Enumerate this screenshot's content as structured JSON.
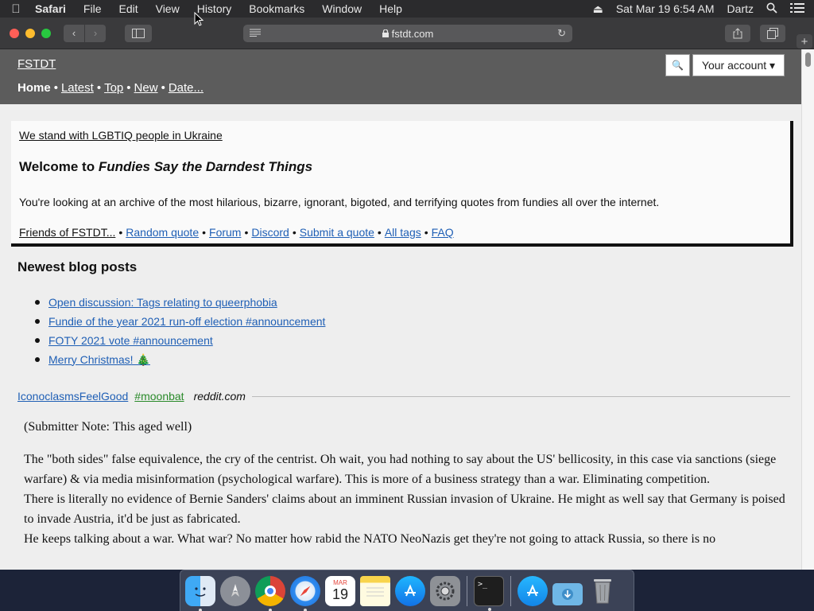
{
  "menubar": {
    "app": "Safari",
    "items": [
      "File",
      "Edit",
      "View",
      "History",
      "Bookmarks",
      "Window",
      "Help"
    ],
    "datetime": "Sat Mar 19  6:54 AM",
    "user": "Dartz"
  },
  "toolbar": {
    "url": "fstdt.com"
  },
  "site": {
    "title": "FSTDT",
    "nav": [
      "Home",
      "Latest",
      "Top",
      "New",
      "Date..."
    ],
    "search_icon": "🔍",
    "account_label": "Your account ▾"
  },
  "welcome": {
    "ukraine": "We stand with LGBTIQ people in Ukraine",
    "heading_prefix": "Welcome to ",
    "heading_em": "Fundies Say the Darndest Things",
    "description": "You're looking at an archive of the most hilarious, bizarre, ignorant, bigoted, and terrifying quotes from fundies all over the internet.",
    "friends": "Friends of FSTDT...",
    "links": [
      "Random quote",
      "Forum",
      "Discord",
      "Submit a quote",
      "All tags",
      "FAQ"
    ]
  },
  "blog": {
    "heading": "Newest blog posts",
    "posts": [
      "Open discussion: Tags relating to queerphobia",
      "Fundie of the year 2021 run-off election #announcement",
      "FOTY 2021 vote #announcement",
      "Merry Christmas! 🎄"
    ]
  },
  "quote": {
    "user": "IconoclasmsFeelGood",
    "tag": "#moonbat",
    "source": "reddit.com",
    "note": "(Submitter Note: This aged well)",
    "paragraphs": [
      "The \"both sides\" false equivalence, the cry of the centrist. Oh wait, you had nothing to say about the US' bellicosity, in this case via sanctions (siege warfare) & via media misinformation (psychological warfare). This is more of a business strategy than a war. Eliminating competition.",
      "There is literally no evidence of Bernie Sanders' claims about an imminent Russian invasion of Ukraine. He might as well say that Germany is poised to invade Austria, it'd be just as fabricated.",
      "He keeps talking about a war. What war? No matter how rabid the NATO NeoNazis get they're not going to attack Russia, so there is no"
    ]
  },
  "dock": {
    "calendar_month": "MAR",
    "calendar_day": "19"
  },
  "icons": [
    "apple-icon",
    "eject-icon",
    "search-icon",
    "control-center-icon",
    "sidebar-icon",
    "share-icon",
    "tabs-icon",
    "reader-icon",
    "reload-icon",
    "lock-icon"
  ]
}
